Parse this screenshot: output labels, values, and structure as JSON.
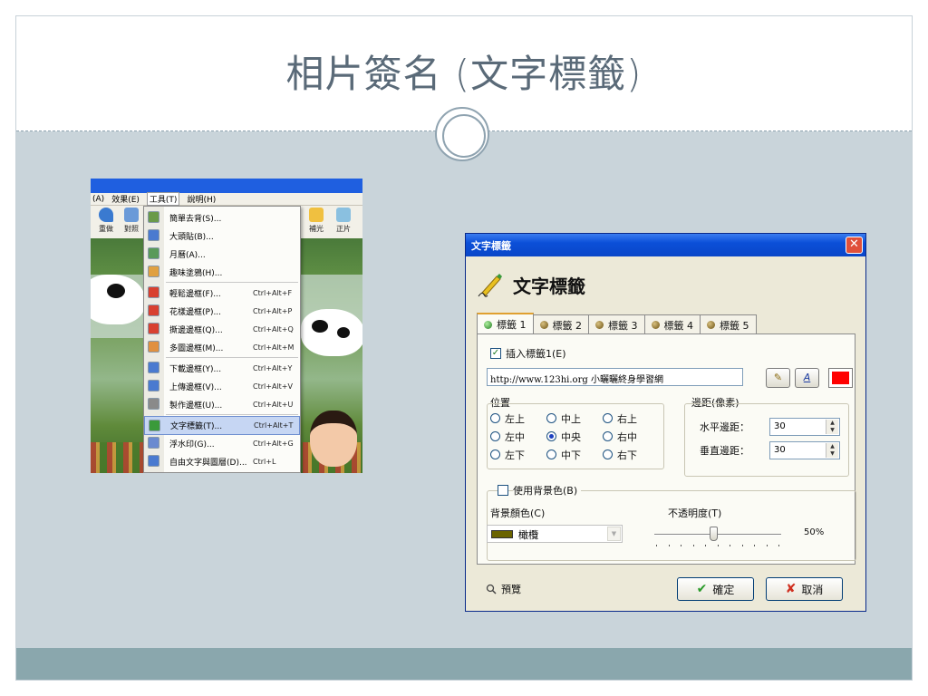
{
  "slide": {
    "title": "相片簽名 (文字標籤)"
  },
  "screenshot": {
    "menubar": [
      "(A)",
      "效果(E)",
      "工具(T)",
      "說明(H)"
    ],
    "toolbar": [
      {
        "label": "重做",
        "icon": "redo-icon"
      },
      {
        "label": "對照",
        "icon": "compare-icon"
      },
      {
        "label": "補光",
        "icon": "fill-light-icon"
      },
      {
        "label": "正片",
        "icon": "positive-film-icon"
      }
    ],
    "tools_menu": [
      {
        "label": "簡單去背(S)...",
        "shortcut": "",
        "color": "#6a9a4a"
      },
      {
        "label": "大頭貼(B)...",
        "shortcut": "",
        "color": "#4a7ad0"
      },
      {
        "label": "月曆(A)...",
        "shortcut": "",
        "color": "#5a9a5a"
      },
      {
        "label": "趣味塗鴉(H)...",
        "shortcut": "",
        "color": "#e0a040"
      },
      {
        "label": "輕鬆邊框(F)...",
        "shortcut": "Ctrl+Alt+F",
        "color": "#d84030"
      },
      {
        "label": "花樣邊框(P)...",
        "shortcut": "Ctrl+Alt+P",
        "color": "#d84030"
      },
      {
        "label": "撕邊邊框(Q)...",
        "shortcut": "Ctrl+Alt+Q",
        "color": "#d84030"
      },
      {
        "label": "多圖邊框(M)...",
        "shortcut": "Ctrl+Alt+M",
        "color": "#e09040"
      },
      {
        "label": "下載邊框(Y)...",
        "shortcut": "Ctrl+Alt+Y",
        "color": "#4a7ad0"
      },
      {
        "label": "上傳邊框(V)...",
        "shortcut": "Ctrl+Alt+V",
        "color": "#4a7ad0"
      },
      {
        "label": "製作邊框(U)...",
        "shortcut": "Ctrl+Alt+U",
        "color": "#8a8a8a"
      },
      {
        "label": "文字標籤(T)...",
        "shortcut": "Ctrl+Alt+T",
        "color": "#3a9a3a"
      },
      {
        "label": "浮水印(G)...",
        "shortcut": "Ctrl+Alt+G",
        "color": "#6a8ad0"
      },
      {
        "label": "自由文字與圖層(D)...",
        "shortcut": "Ctrl+L",
        "color": "#4a7ad0"
      }
    ]
  },
  "dialog": {
    "window_title": "文字標籤",
    "heading": "文字標籤",
    "tabs": [
      "標籤 1",
      "標籤 2",
      "標籤 3",
      "標籤 4",
      "標籤 5"
    ],
    "insert_checkbox_label": "插入標籤1(E)",
    "insert_checked": true,
    "text_value": "http://www.123hi.org 小曬曬終身學習網",
    "font_button": "A",
    "pencil_button": "✎",
    "text_color": "#ff0000",
    "position_group_label": "位置",
    "positions": [
      {
        "label": "左上",
        "selected": false
      },
      {
        "label": "中上",
        "selected": false
      },
      {
        "label": "右上",
        "selected": false
      },
      {
        "label": "左中",
        "selected": false
      },
      {
        "label": "中央",
        "selected": true
      },
      {
        "label": "右中",
        "selected": false
      },
      {
        "label": "左下",
        "selected": false
      },
      {
        "label": "中下",
        "selected": false
      },
      {
        "label": "右下",
        "selected": false
      }
    ],
    "margin_group_label": "邊距(像素)",
    "h_margin_label": "水平邊距：",
    "h_margin_value": "30",
    "v_margin_label": "垂直邊距：",
    "v_margin_value": "30",
    "bg_checkbox_label": "使用背景色(B)",
    "bg_checked": false,
    "bg_color_label": "背景顏色(C)",
    "bg_color_name": "橄欖",
    "bg_color": "#6b6400",
    "opacity_label": "不透明度(T)",
    "opacity_value": "50%",
    "opacity_fraction": 0.5,
    "preview_label": "預覽",
    "ok_label": "確定",
    "cancel_label": "取消"
  }
}
